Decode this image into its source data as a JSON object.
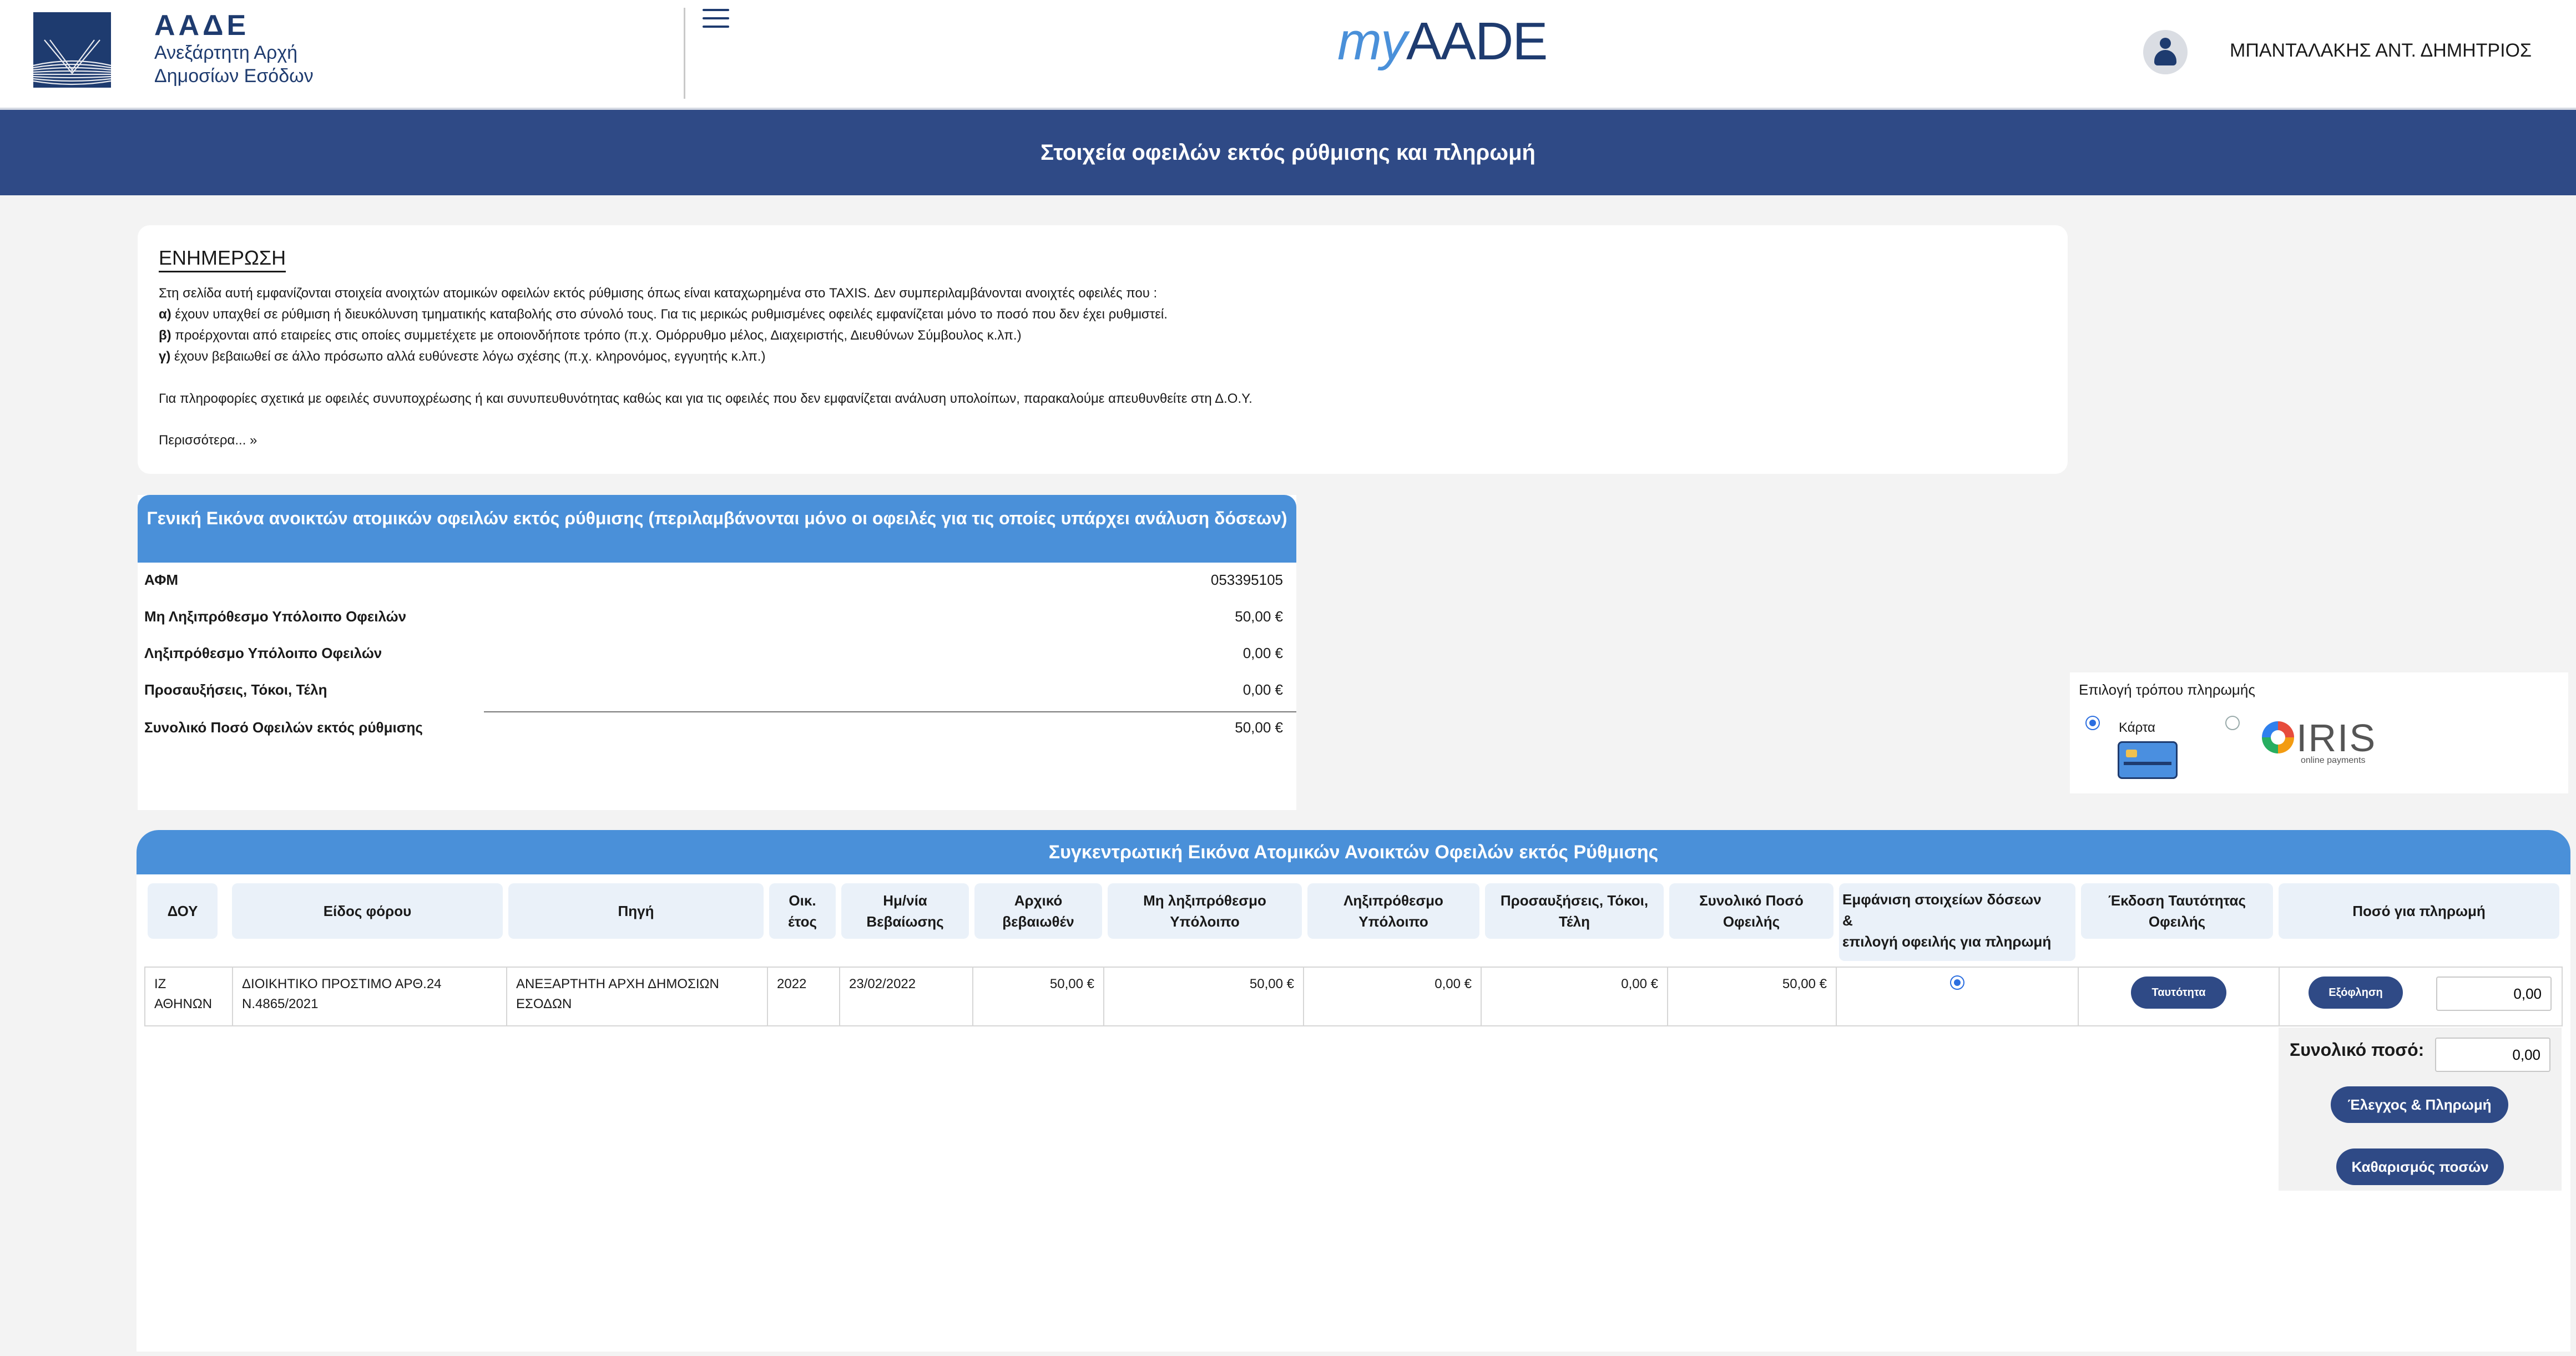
{
  "header": {
    "logo_abbr": "ΑΑΔΕ",
    "logo_line1": "Ανεξάρτητη Αρχή",
    "logo_line2": "Δημοσίων Εσόδων",
    "app_my": "my",
    "app_name": "AADE",
    "user_name": "ΜΠΑΝΤΑΛΑΚΗΣ ΑΝΤ. ΔΗΜΗΤΡΙΟΣ",
    "page_title": "Στοιχεία οφειλών εκτός ρύθμισης και πληρωμή"
  },
  "info": {
    "title": "ΕΝΗΜΕΡΩΣΗ",
    "intro": "Στη σελίδα αυτή εμφανίζονται στοιχεία ανοιχτών ατομικών οφειλών εκτός ρύθμισης όπως είναι καταχωρημένα στο TAXIS. Δεν συμπεριλαμβάνονται ανοιχτές οφειλές που :",
    "items": [
      {
        "marker": "α)",
        "text": " έχουν υπαχθεί σε ρύθμιση ή διευκόλυνση τμηματικής καταβολής στο σύνολό τους. Για τις μερικώς ρυθμισμένες οφειλές εμφανίζεται μόνο το ποσό που δεν έχει ρυθμιστεί."
      },
      {
        "marker": "β)",
        "text": " προέρχονται από εταιρείες στις οποίες συμμετέχετε με οποιονδήποτε τρόπο (π.χ. Ομόρρυθμο μέλος, Διαχειριστής, Διευθύνων Σύμβουλος κ.λπ.)"
      },
      {
        "marker": "γ)",
        "text": " έχουν βεβαιωθεί σε άλλο πρόσωπο αλλά ευθύνεστε λόγω σχέσης (π.χ. κληρονόμος, εγγυητής κ.λπ.)"
      }
    ],
    "footer_text": "Για πληροφορίες σχετικά με οφειλές συνυποχρέωσης ή και συνυπευθυνότητας καθώς και για τις οφειλές που δεν εμφανίζεται ανάλυση υπολοίπων, παρακαλούμε απευθυνθείτε στη Δ.Ο.Υ.",
    "more_link": "Περισσότερα... »"
  },
  "overview": {
    "title": "Γενική Εικόνα ανοικτών ατομικών οφειλών εκτός ρύθμισης (περιλαμβάνονται μόνο οι οφειλές για τις οποίες υπάρχει ανάλυση δόσεων)",
    "rows": [
      {
        "label": "ΑΦΜ",
        "value": "053395105"
      },
      {
        "label": "Μη Ληξιπρόθεσμο Υπόλοιπο Οφειλών",
        "value": "50,00 €"
      },
      {
        "label": "Ληξιπρόθεσμο Υπόλοιπο Οφειλών",
        "value": "0,00 €"
      },
      {
        "label": "Προσαυξήσεις, Τόκοι, Τέλη",
        "value": "0,00 €"
      },
      {
        "label": "Συνολικό Ποσό Οφειλών εκτός ρύθμισης",
        "value": "50,00 €"
      }
    ]
  },
  "payment": {
    "label": "Επιλογή τρόπου πληρωμής",
    "card_label": "Κάρτα",
    "iris_word": "IRIS",
    "iris_sub": "online payments",
    "selected": "card"
  },
  "summary": {
    "title": "Συγκεντρωτική Εικόνα Ατομικών Ανοικτών Οφειλών εκτός Ρύθμισης",
    "headers": {
      "doy": "ΔΟΥ",
      "tax_type": "Είδος φόρου",
      "source": "Πηγή",
      "fiscal_year": "Οικ. έτος",
      "cert_date": "Ημ/νία Βεβαίωσης",
      "initial": "Αρχικό βεβαιωθέν",
      "not_overdue": "Μη ληξιπρόθεσμο Υπόλοιπο",
      "overdue": "Ληξιπρόθεσμο Υπόλοιπο",
      "surcharges": "Προσαυξήσεις, Τόκοι, Τέλη",
      "total": "Συνολικό Ποσό Οφειλής",
      "show_installments_1": "Εμφάνιση στοιχείων δόσεων",
      "show_installments_2": "&",
      "show_installments_3": "επιλογή οφειλής για πληρωμή",
      "id_issue": "Έκδοση Ταυτότητας Οφειλής",
      "pay_amount": "Ποσό για πληρωμή"
    },
    "row": {
      "doy": "ΙΖ ΑΘΗΝΩΝ",
      "tax_type": "ΔΙΟΙΚΗΤΙΚΟ ΠΡΟΣΤΙΜΟ ΑΡΘ.24 Ν.4865/2021",
      "source": "ΑΝΕΞΑΡΤΗΤΗ ΑΡΧΗ ΔΗΜΟΣΙΩΝ ΕΣΟΔΩΝ",
      "fiscal_year": "2022",
      "cert_date": "23/02/2022",
      "initial": "50,00 €",
      "not_overdue": "50,00 €",
      "overdue": "0,00 €",
      "surcharges": "0,00 €",
      "total": "50,00 €",
      "id_button": "Ταυτότητα",
      "settle_button": "Εξόφληση",
      "pay_amount": "0,00"
    },
    "total_label": "Συνολικό ποσό:",
    "total_value": "0,00",
    "check_pay_button": "Έλεγχος & Πληρωμή",
    "clear_button": "Καθαρισμός ποσών"
  }
}
